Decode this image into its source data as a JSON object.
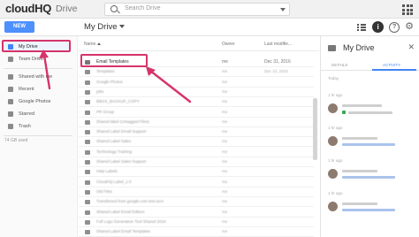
{
  "app": {
    "logo": "cloudHQ",
    "product": "Drive"
  },
  "search": {
    "placeholder": "Search Drive"
  },
  "toolbar": {
    "new_label": "NEW",
    "breadcrumb": "My Drive"
  },
  "sidebar": {
    "items": [
      {
        "label": "My Drive",
        "active": true,
        "icon": "drive-icon"
      },
      {
        "label": "Team Drive",
        "active": false,
        "icon": "team-drive-icon"
      },
      {
        "label": "Shared with me",
        "active": false,
        "icon": "shared-icon"
      },
      {
        "label": "Recent",
        "active": false,
        "icon": "clock-icon"
      },
      {
        "label": "Google Photos",
        "active": false,
        "icon": "photos-icon"
      },
      {
        "label": "Starred",
        "active": false,
        "icon": "star-icon"
      },
      {
        "label": "Trash",
        "active": false,
        "icon": "trash-icon"
      }
    ],
    "storage": "74 GB used"
  },
  "file_list": {
    "columns": {
      "name": "Name",
      "owner": "Owner",
      "modified": "Last modifie..."
    },
    "rows": [
      {
        "name": "Email Templates",
        "owner": "me",
        "modified": "Dec 31, 2016"
      },
      {
        "name": "Templates",
        "owner": "me",
        "modified": "Dec 10, 2016"
      },
      {
        "name": "Google Photos",
        "owner": "me",
        "modified": ""
      },
      {
        "name": "jobs",
        "owner": "me",
        "modified": ""
      },
      {
        "name": "BBGS_BACKUP_COPY",
        "owner": "me",
        "modified": ""
      },
      {
        "name": "PR Group",
        "owner": "me",
        "modified": ""
      },
      {
        "name": "Shared label (Untagged Files)",
        "owner": "me",
        "modified": ""
      },
      {
        "name": "Shared Label Email Support",
        "owner": "me",
        "modified": ""
      },
      {
        "name": "Shared Label Sales",
        "owner": "me",
        "modified": ""
      },
      {
        "name": "Technology Training",
        "owner": "me",
        "modified": ""
      },
      {
        "name": "Shared Label Sales Support",
        "owner": "me",
        "modified": ""
      },
      {
        "name": "Help Labels",
        "owner": "me",
        "modified": ""
      },
      {
        "name": "CloudHQ Label_1.0",
        "owner": "me",
        "modified": ""
      },
      {
        "name": "Old Files",
        "owner": "me",
        "modified": ""
      },
      {
        "name": "Transferred from google.com test acct",
        "owner": "me",
        "modified": ""
      },
      {
        "name": "Shared Label Email Editors",
        "owner": "me",
        "modified": ""
      },
      {
        "name": "Full Logo Generation Tool Shared 2016",
        "owner": "me",
        "modified": ""
      },
      {
        "name": "Shared Label Email Templates",
        "owner": "me",
        "modified": ""
      }
    ]
  },
  "details": {
    "title": "My Drive",
    "tabs": [
      "DETAILS",
      "ACTIVITY"
    ],
    "active_tab": "ACTIVITY",
    "sections": [
      "Today",
      "1 hr ago",
      "1 hr ago",
      "1 hr ago",
      "1 hr ago"
    ]
  },
  "colors": {
    "accent": "#4285f4",
    "new_button": "#4d90fe",
    "annotation": "#d6336c"
  }
}
